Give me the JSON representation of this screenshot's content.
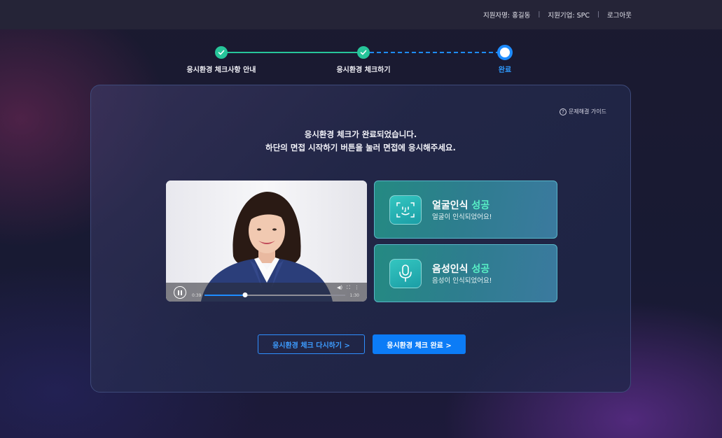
{
  "header": {
    "applicant": "지원자명: 홍길동",
    "company": "지원기업: SPC",
    "logout": "로그아웃"
  },
  "steps": [
    {
      "label": "응시환경 체크사항 안내",
      "status": "done"
    },
    {
      "label": "응시환경 체크하기",
      "status": "done"
    },
    {
      "label": "완료",
      "status": "current"
    }
  ],
  "panel": {
    "guide": "문제해결 가이드",
    "message_line1": "응시환경 체크가 완료되었습니다.",
    "message_line2": "하단의 면접 시작하기 버튼을 눌러 면접에 응시해주세요."
  },
  "video": {
    "current_time": "0:39",
    "duration": "1:30",
    "progress": 0.29
  },
  "face_check": {
    "title": "얼굴인식",
    "result": "성공",
    "subtitle": "얼굴이 인식되었어요!"
  },
  "voice_check": {
    "title": "음성인식",
    "result": "성공",
    "subtitle": "음성이 인식되었어요!"
  },
  "buttons": {
    "retry": "응시환경 체크 다시하기 >",
    "complete": "응시환경 체크 완료 >"
  },
  "colors": {
    "accent": "#1e8cff",
    "success": "#27c59a",
    "card": "#248a82"
  }
}
